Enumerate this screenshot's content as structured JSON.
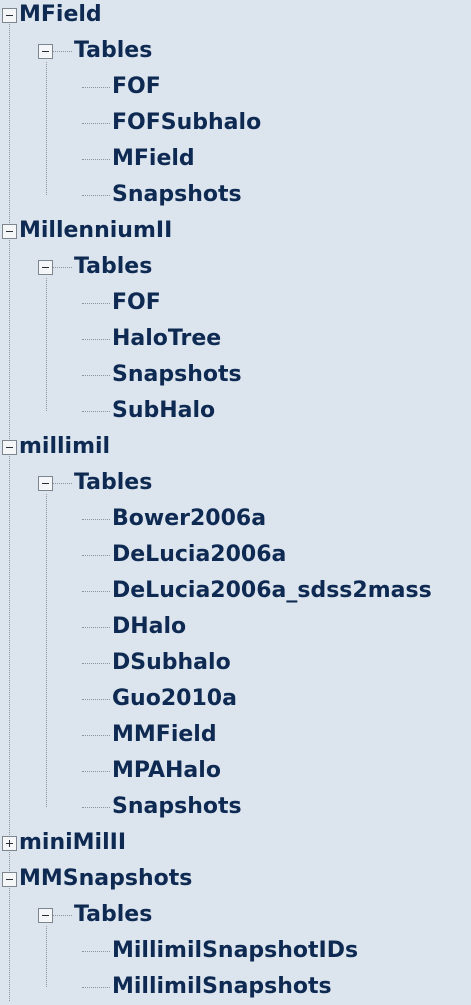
{
  "tree": [
    {
      "label": "MField",
      "expanded": true,
      "children": [
        {
          "label": "Tables",
          "expanded": true,
          "children": [
            {
              "label": "FOF"
            },
            {
              "label": "FOFSubhalo"
            },
            {
              "label": "MField"
            },
            {
              "label": "Snapshots"
            }
          ]
        }
      ]
    },
    {
      "label": "MillenniumII",
      "expanded": true,
      "children": [
        {
          "label": "Tables",
          "expanded": true,
          "children": [
            {
              "label": "FOF"
            },
            {
              "label": "HaloTree"
            },
            {
              "label": "Snapshots"
            },
            {
              "label": "SubHalo"
            }
          ]
        }
      ]
    },
    {
      "label": "millimil",
      "expanded": true,
      "children": [
        {
          "label": "Tables",
          "expanded": true,
          "children": [
            {
              "label": "Bower2006a"
            },
            {
              "label": "DeLucia2006a"
            },
            {
              "label": "DeLucia2006a_sdss2mass"
            },
            {
              "label": "DHalo"
            },
            {
              "label": "DSubhalo"
            },
            {
              "label": "Guo2010a"
            },
            {
              "label": "MMField"
            },
            {
              "label": "MPAHalo"
            },
            {
              "label": "Snapshots"
            }
          ]
        }
      ]
    },
    {
      "label": "miniMilII",
      "expanded": false
    },
    {
      "label": "MMSnapshots",
      "expanded": true,
      "children": [
        {
          "label": "Tables",
          "expanded": true,
          "children": [
            {
              "label": "MillimilSnapshotIDs"
            },
            {
              "label": "MillimilSnapshots"
            }
          ]
        }
      ]
    }
  ]
}
